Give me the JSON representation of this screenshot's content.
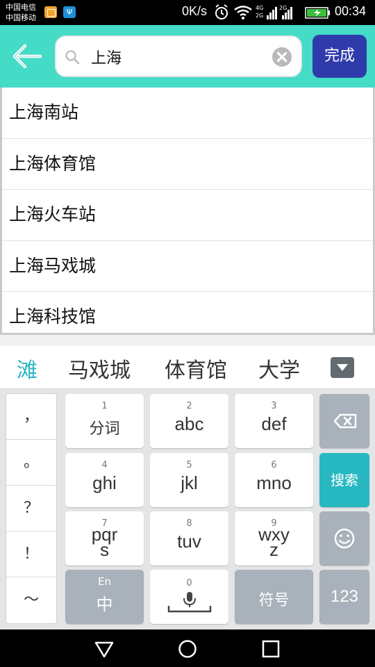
{
  "status_bar": {
    "carrier_1": "中国电信",
    "carrier_2": "中国移动",
    "usb_symbol": "Ψ",
    "net_speed": "0K/s",
    "net_4g": "4G",
    "net_2g_a": "2G",
    "net_2g_b": "2G",
    "time": "00:34",
    "icons": [
      "gallery-notification-icon",
      "usb-icon",
      "alarm-icon",
      "wifi-icon",
      "signal-icon",
      "battery-charging-icon"
    ]
  },
  "header": {
    "search_value": "上海",
    "done_label": "完成",
    "accent_color": "#44dbc7",
    "done_color": "#2f3bab"
  },
  "suggestions": [
    "上海南站",
    "上海体育馆",
    "上海火车站",
    "上海马戏城",
    "上海科技馆"
  ],
  "candidates": [
    "滩",
    "马戏城",
    "体育馆",
    "大学"
  ],
  "keyboard": {
    "punctuation": [
      "，",
      "。",
      "？",
      "！",
      "～"
    ],
    "keys": [
      {
        "num": "1",
        "label": "分词"
      },
      {
        "num": "2",
        "label": "abc"
      },
      {
        "num": "3",
        "label": "def"
      },
      {
        "num": "4",
        "label": "ghi"
      },
      {
        "num": "5",
        "label": "jkl"
      },
      {
        "num": "6",
        "label": "mno"
      },
      {
        "num": "7",
        "label": "pqr",
        "label2": "s"
      },
      {
        "num": "8",
        "label": "tuv"
      },
      {
        "num": "9",
        "label": "wxy",
        "label2": "z"
      }
    ],
    "lang_small": "En",
    "lang_label": "中",
    "space_num": "0",
    "symbol_label": "符号",
    "search_label": "搜索",
    "num_label": "123",
    "search_color": "#27b8c2"
  }
}
